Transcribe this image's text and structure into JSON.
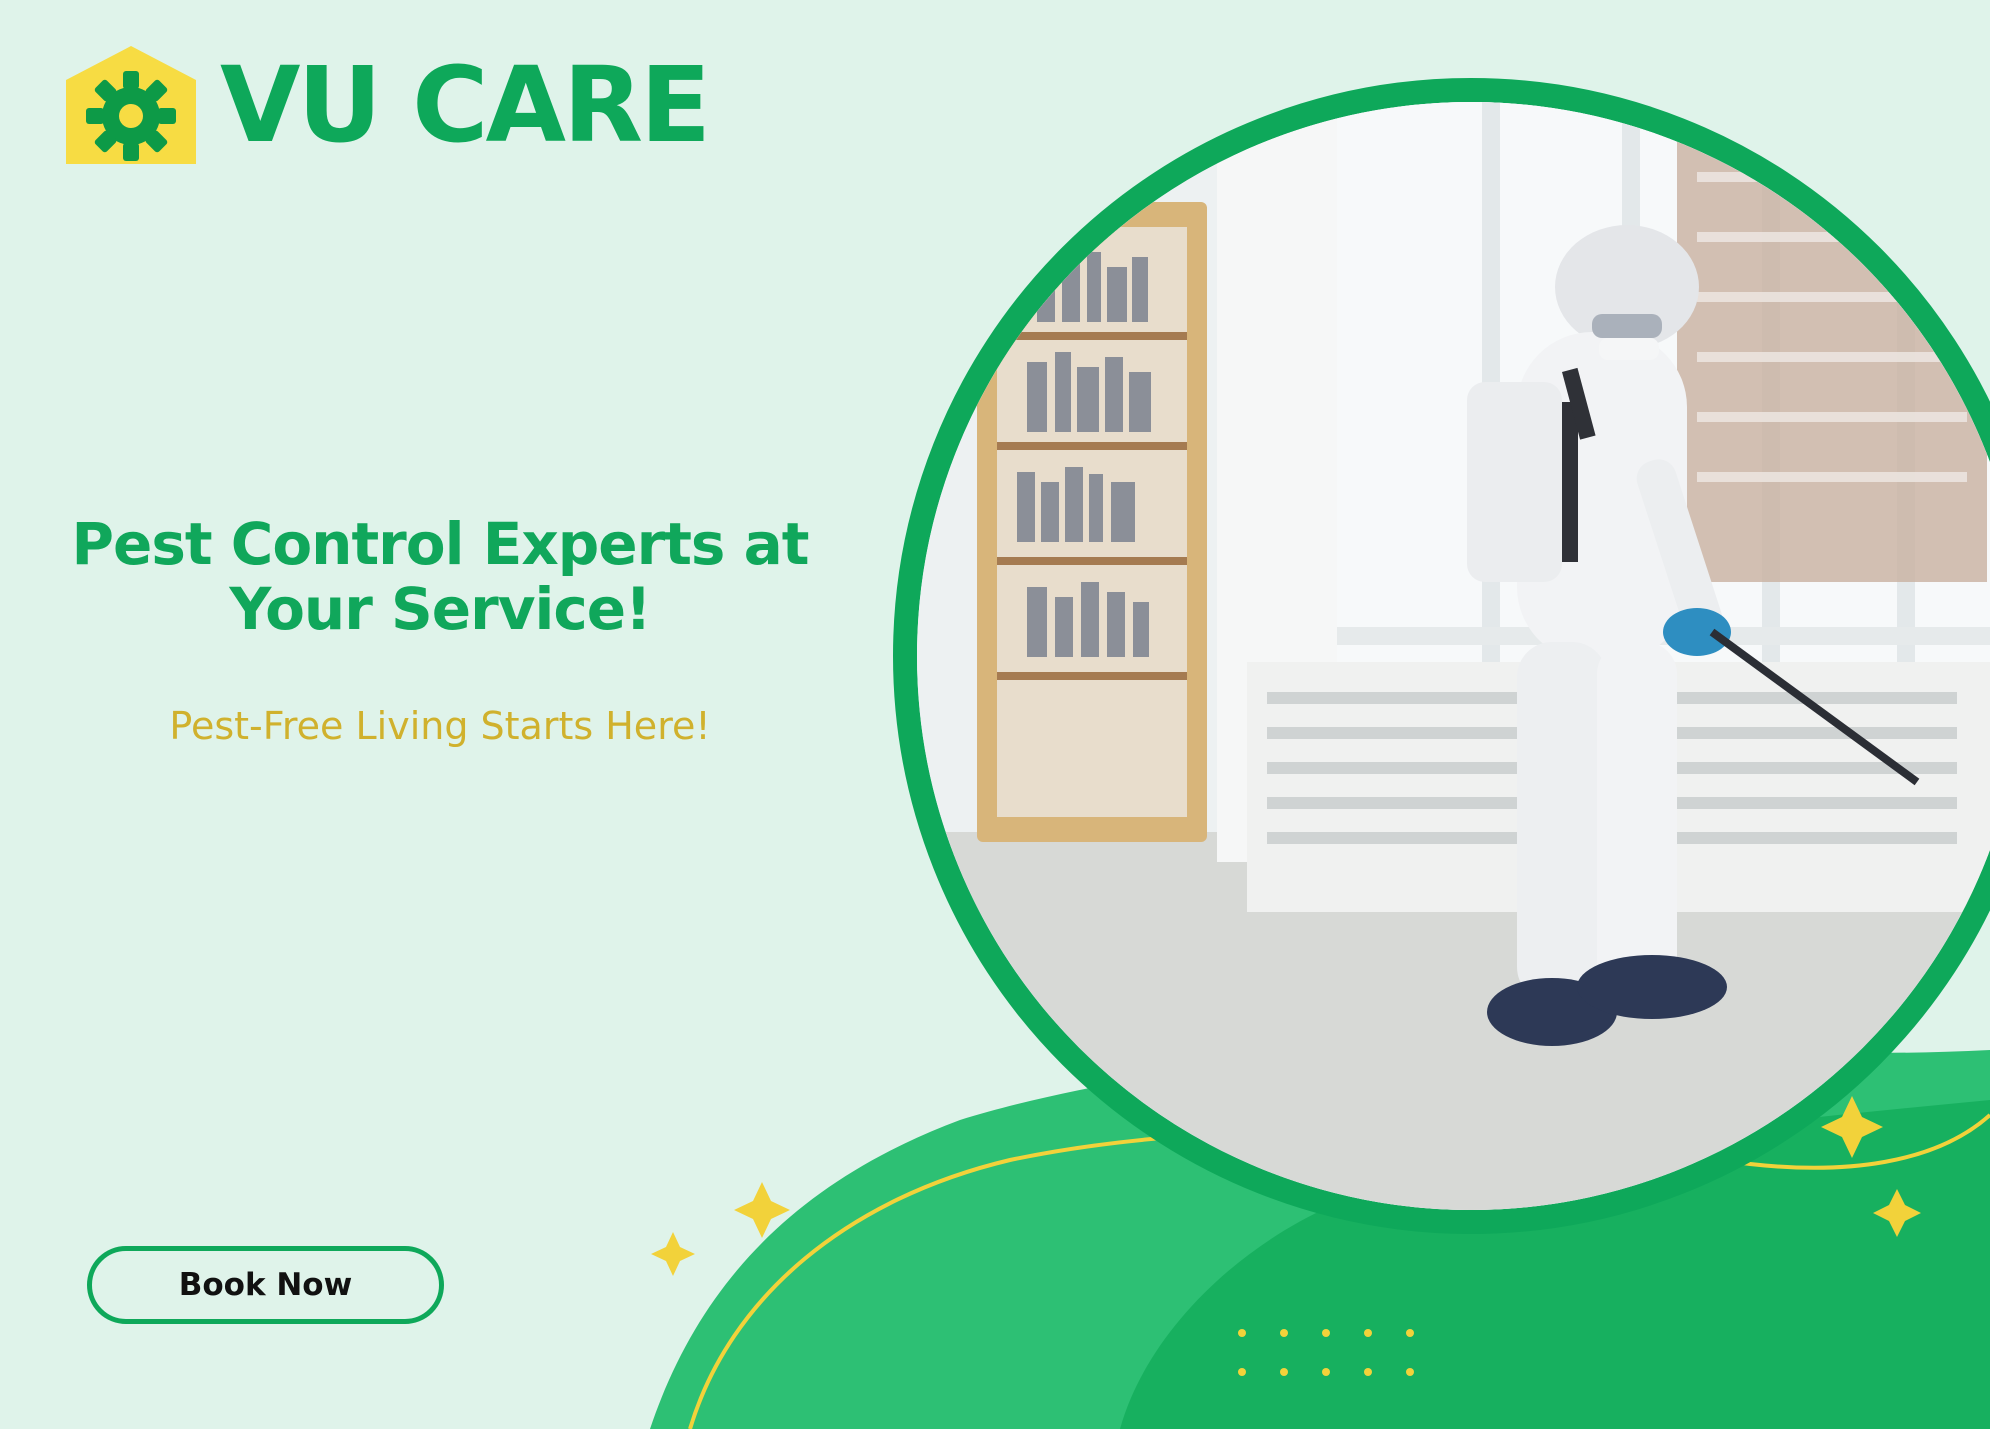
{
  "brand": {
    "name": "VU CARE",
    "logo_icon": "house-gear-icon"
  },
  "hero": {
    "headline": "Pest Control Experts at Your Service!",
    "subheadline": "Pest-Free Living Starts Here!",
    "cta_label": "Book Now"
  },
  "photo": {
    "icon": "pest-control-technician-photo"
  },
  "decor": {
    "sparkles": [
      "sparkle-icon",
      "sparkle-icon",
      "sparkle-icon",
      "sparkle-icon"
    ],
    "dots_icon": "dot-grid-icon"
  },
  "colors": {
    "background": "#dff3ea",
    "brand_green": "#0ea85a",
    "wave_green": "#22b86b",
    "accent_yellow": "#f2d23a",
    "subheadline_yellow": "#d0b12d",
    "button_text": "#111111"
  }
}
